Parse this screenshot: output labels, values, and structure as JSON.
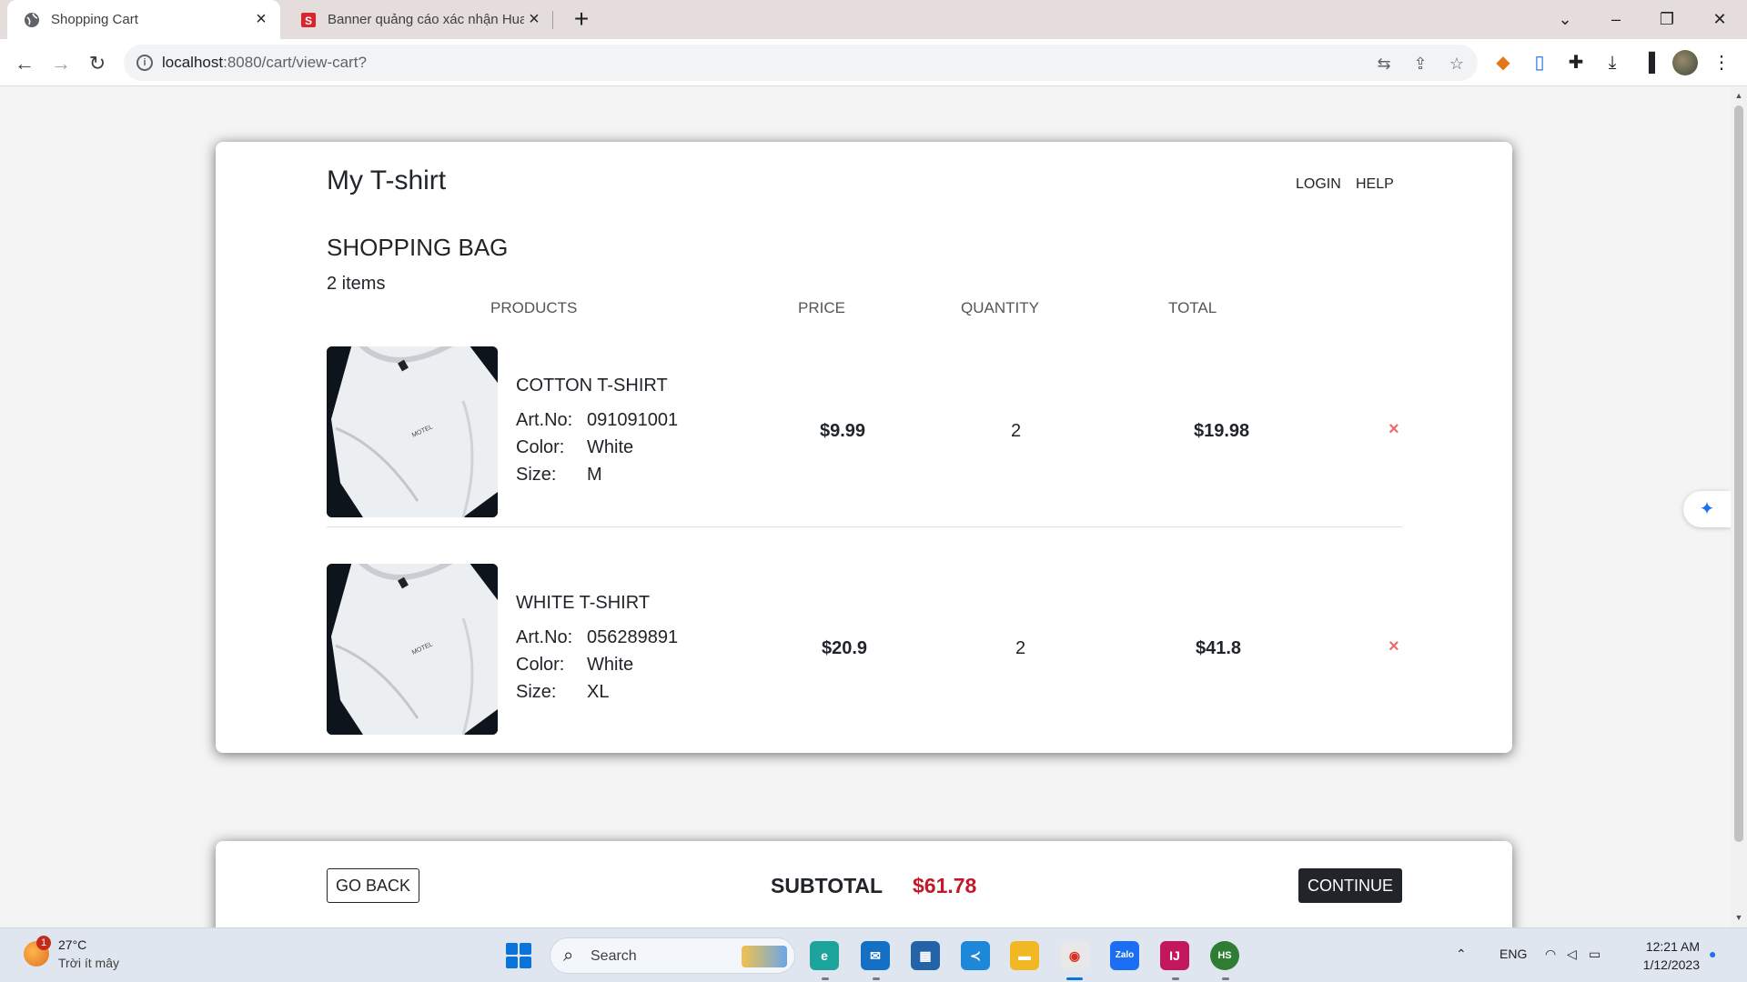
{
  "browser": {
    "tabs": [
      {
        "title": "Shopping Cart",
        "active": true
      },
      {
        "title": "Banner quảng cáo xác nhận Hua",
        "active": false
      }
    ],
    "url_host": "localhost",
    "url_rest": ":8080/cart/view-cart?"
  },
  "page": {
    "brand": "My T-shirt",
    "nav": {
      "login": "LOGIN",
      "help": "HELP"
    },
    "bag_title": "SHOPPING BAG",
    "item_count": "2 items",
    "columns": {
      "products": "PRODUCTS",
      "price": "PRICE",
      "quantity": "QUANTITY",
      "total": "TOTAL"
    },
    "items": [
      {
        "name": "COTTON T-SHIRT",
        "art_label": "Art.No:",
        "art_no": "091091001",
        "color_label": "Color:",
        "color": "White",
        "size_label": "Size:",
        "size": "M",
        "price": "$9.99",
        "quantity": "2",
        "total": "$19.98",
        "remove": "×"
      },
      {
        "name": "WHITE T-SHIRT",
        "art_label": "Art.No:",
        "art_no": "056289891",
        "color_label": "Color:",
        "color": "White",
        "size_label": "Size:",
        "size": "XL",
        "price": "$20.9",
        "quantity": "2",
        "total": "$41.8",
        "remove": "×"
      }
    ],
    "footer": {
      "go_back": "GO BACK",
      "subtotal_label": "SUBTOTAL",
      "subtotal_value": "$61.78",
      "continue": "CONTINUE"
    }
  },
  "taskbar": {
    "weather_temp": "27°C",
    "weather_desc": "Trời ít mây",
    "weather_badge": "1",
    "search_label": "Search",
    "tray_lang": "ENG",
    "time": "12:21 AM",
    "date": "1/12/2023"
  },
  "colors": {
    "subtotal": "#c0192b",
    "remove": "#ef6b6b",
    "continue_bg": "#212529"
  }
}
